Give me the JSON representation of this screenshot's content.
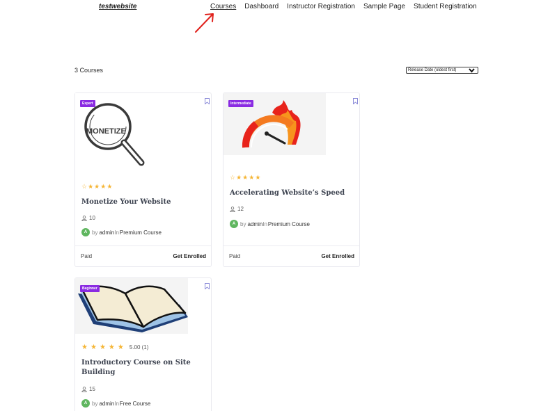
{
  "header": {
    "site_title": "testwebsite",
    "nav": [
      "Courses",
      "Dashboard",
      "Instructor Registration",
      "Sample Page",
      "Student Registration"
    ]
  },
  "toolbar": {
    "count": "3 Courses",
    "sort_selected": "Release Date (oldest first)"
  },
  "colors": {
    "level_badge": "#8a2be2",
    "star": "#f5b534",
    "avatar": "#5fb65f"
  },
  "courses": [
    {
      "level": "Expert",
      "thumbnail_text": "MONETIZE",
      "title": "Monetize Your Website",
      "rating": "",
      "students": "10",
      "by": "by",
      "author": "admin",
      "in": "In",
      "category": "Premium Course",
      "avatar_letter": "A",
      "price": "Paid",
      "action": "Get Enrolled"
    },
    {
      "level": "Intermediate",
      "title": "Accelerating Website’s Speed",
      "rating": "",
      "students": "12",
      "by": "by",
      "author": "admin",
      "in": "In",
      "category": "Premium Course",
      "avatar_letter": "A",
      "price": "Paid",
      "action": "Get Enrolled"
    },
    {
      "level": "Beginner",
      "title": "Introductory Course on Site Building",
      "rating": "5.00 (1)",
      "students": "15",
      "by": "by",
      "author": "admin",
      "in": "In",
      "category": "Free Course",
      "avatar_letter": "A"
    }
  ]
}
